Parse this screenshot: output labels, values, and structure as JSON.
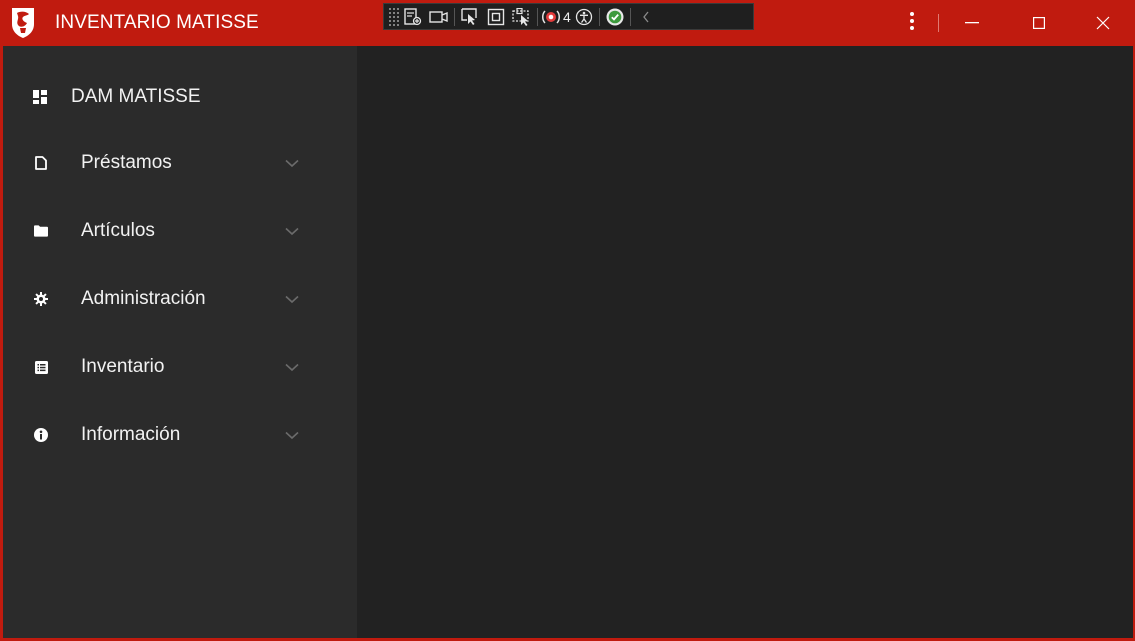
{
  "window": {
    "title": "INVENTARIO MATISSE"
  },
  "debug_toolbar": {
    "tools": [
      "live-visual-tree-icon",
      "record-icon",
      "select-element-icon",
      "display-layout-adorners-icon",
      "track-focus-icon",
      "binding-failures-icon",
      "accessibility-icon",
      "hot-reload-ok-icon",
      "collapse-icon"
    ],
    "binding_failures_count": "4"
  },
  "sidebar": {
    "header": {
      "label": "DAM MATISSE",
      "icon": "dashboard-icon"
    },
    "items": [
      {
        "label": "Préstamos",
        "icon": "file-icon"
      },
      {
        "label": "Artículos",
        "icon": "folder-icon"
      },
      {
        "label": "Administración",
        "icon": "gear-icon"
      },
      {
        "label": "Inventario",
        "icon": "list-box-icon"
      },
      {
        "label": "Información",
        "icon": "info-icon"
      }
    ]
  },
  "colors": {
    "accent": "#c01b0f",
    "sidebar_bg": "#2b2b2b",
    "content_bg": "#222222",
    "chevron": "#6b6b6b"
  }
}
